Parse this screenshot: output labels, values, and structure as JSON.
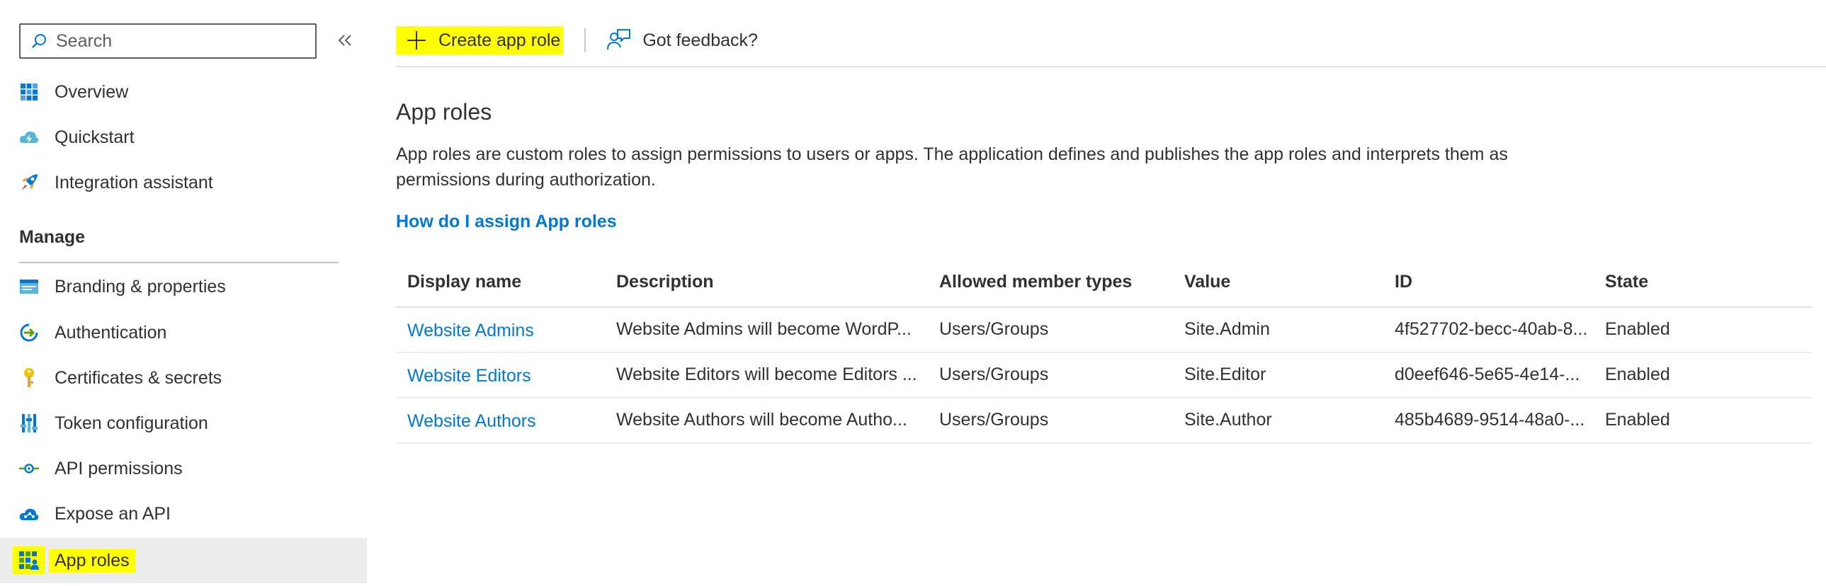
{
  "sidebar": {
    "search_placeholder": "Search",
    "collapse_icon": "double-chevron-left-icon",
    "items_top": [
      {
        "label": "Overview",
        "icon": "grid-icon"
      },
      {
        "label": "Quickstart",
        "icon": "cloud-lightning-icon"
      },
      {
        "label": "Integration assistant",
        "icon": "rocket-icon"
      }
    ],
    "manage_header": "Manage",
    "items_manage": [
      {
        "label": "Branding & properties",
        "icon": "branding-icon"
      },
      {
        "label": "Authentication",
        "icon": "authentication-icon"
      },
      {
        "label": "Certificates & secrets",
        "icon": "key-icon"
      },
      {
        "label": "Token configuration",
        "icon": "token-bars-icon"
      },
      {
        "label": "API permissions",
        "icon": "api-permissions-icon"
      },
      {
        "label": "Expose an API",
        "icon": "cloud-api-icon"
      },
      {
        "label": "App roles",
        "icon": "app-roles-icon",
        "active": true
      }
    ]
  },
  "toolbar": {
    "create_label": "Create app role",
    "feedback_label": "Got feedback?"
  },
  "main": {
    "title": "App roles",
    "description": "App roles are custom roles to assign permissions to users or apps. The application defines and publishes the app roles and interprets them as permissions during authorization.",
    "help_link": "How do I assign App roles"
  },
  "table": {
    "headers": [
      "Display name",
      "Description",
      "Allowed member types",
      "Value",
      "ID",
      "State"
    ],
    "rows": [
      {
        "display_name": "Website Admins",
        "description": "Website Admins will become WordP...",
        "member_types": "Users/Groups",
        "value": "Site.Admin",
        "id": "4f527702-becc-40ab-8...",
        "state": "Enabled"
      },
      {
        "display_name": "Website Editors",
        "description": "Website Editors will become Editors ...",
        "member_types": "Users/Groups",
        "value": "Site.Editor",
        "id": "d0eef646-5e65-4e14-...",
        "state": "Enabled"
      },
      {
        "display_name": "Website Authors",
        "description": "Website Authors will become Autho...",
        "member_types": "Users/Groups",
        "value": "Site.Author",
        "id": "485b4689-9514-48a0-...",
        "state": "Enabled"
      }
    ]
  },
  "colors": {
    "accent": "#0078d4",
    "highlight": "#ffff00",
    "active_bg": "#ececec"
  }
}
